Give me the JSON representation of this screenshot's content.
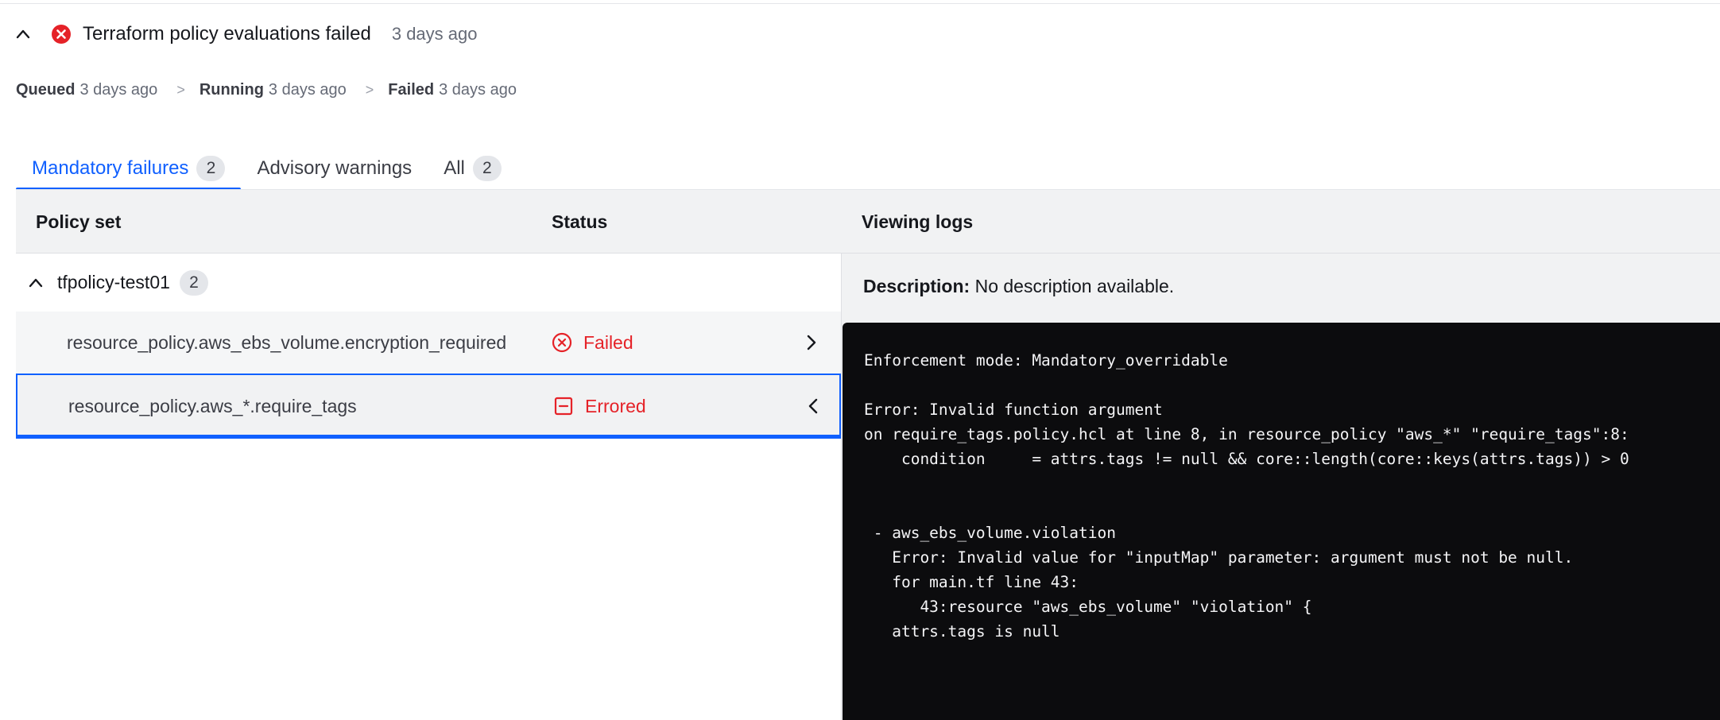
{
  "header": {
    "title": "Terraform policy evaluations failed",
    "time_ago": "3 days ago"
  },
  "timeline": [
    {
      "label": "Queued",
      "time": "3 days ago"
    },
    {
      "label": "Running",
      "time": "3 days ago"
    },
    {
      "label": "Failed",
      "time": "3 days ago"
    }
  ],
  "timeline_sep": ">",
  "tabs": [
    {
      "label": "Mandatory failures",
      "count": "2"
    },
    {
      "label": "Advisory warnings"
    },
    {
      "label": "All",
      "count": "2"
    }
  ],
  "table": {
    "col_policy": "Policy set",
    "col_status": "Status",
    "col_logs": "Viewing logs"
  },
  "group": {
    "name": "tfpolicy-test01",
    "count": "2"
  },
  "rows": [
    {
      "name": "resource_policy.aws_ebs_volume.encryption_required",
      "status": "Failed"
    },
    {
      "name": "resource_policy.aws_*.require_tags",
      "status": "Errored"
    }
  ],
  "details": {
    "desc_label": "Description:",
    "desc_value": "No description available.",
    "log": "Enforcement mode: Mandatory_overridable\n\nError: Invalid function argument\non require_tags.policy.hcl at line 8, in resource_policy \"aws_*\" \"require_tags\":8:\n    condition     = attrs.tags != null && core::length(core::keys(attrs.tags)) > 0\n\n\n - aws_ebs_volume.violation\n   Error: Invalid value for \"inputMap\" parameter: argument must not be null.\n   for main.tf line 43:\n      43:resource \"aws_ebs_volume\" \"violation\" {\n   attrs.tags is null"
  },
  "colors": {
    "accent": "#1060ff",
    "error": "#e52228",
    "log_bg": "#0c0c0e"
  },
  "icons": {
    "collapse": "chevron-up-icon",
    "header_status": "error-circle-x-icon",
    "failed": "x-circle-outline-icon",
    "errored": "minus-square-icon",
    "row1_action": "chevron-right-icon",
    "row2_action": "chevron-left-icon"
  }
}
